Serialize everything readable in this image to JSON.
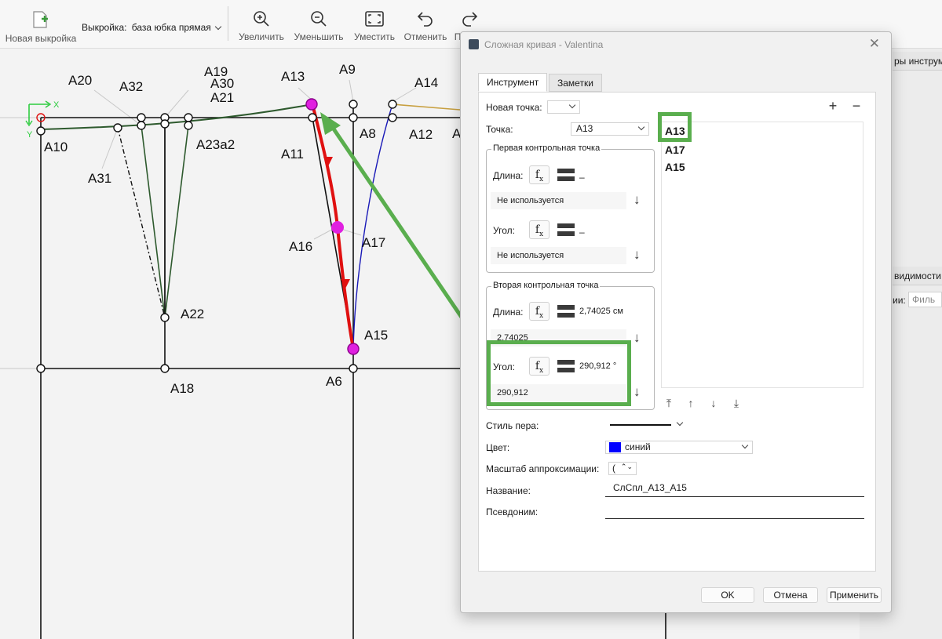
{
  "toolbar": {
    "new_pattern_label": "Новая выкройка",
    "pattern_label": "Выкройка:",
    "pattern_value": "база юбка прямая",
    "zoom_in_label": "Увеличить",
    "zoom_out_label": "Уменьшить",
    "fit_label": "Уместить",
    "undo_label": "Отменить",
    "redo_label": "П"
  },
  "canvas": {
    "axis_x": "X",
    "axis_y": "Y",
    "points": [
      "A20",
      "A32",
      "A19",
      "A30",
      "A21",
      "A13",
      "A9",
      "A14",
      "A10",
      "A23a2",
      "A8",
      "A12",
      "A",
      "A31",
      "A11",
      "A16",
      "A17",
      "A22",
      "A15",
      "A18",
      "A6"
    ]
  },
  "dock": {
    "tools_header": "ры инструм",
    "visibility_header": "видимости",
    "layer_label": "ии:",
    "filter_placeholder": "Филь"
  },
  "dialog": {
    "title": "Сложная кривая - Valentina",
    "tabs": [
      "Инструмент",
      "Заметки"
    ],
    "new_point_label": "Новая точка:",
    "point_label": "Точка:",
    "point_value": "A13",
    "first_cp": {
      "title": "Первая контрольная точка",
      "length_label": "Длина:",
      "length_value": "–",
      "length_formula": "Не используется",
      "angle_label": "Угол:",
      "angle_value": "–",
      "angle_formula": "Не используется"
    },
    "second_cp": {
      "title": "Вторая контрольная точка",
      "length_label": "Длина:",
      "length_value": "2,74025 см",
      "length_formula": "2,74025",
      "angle_label": "Угол:",
      "angle_value": "290,912 °",
      "angle_formula": "290,912"
    },
    "point_list": [
      "A13",
      "A17",
      "A15"
    ],
    "pen_style_label": "Стиль пера:",
    "color_label": "Цвет:",
    "color_value": "синий",
    "color_swatch": "#0000ff",
    "approx_label": "Масштаб аппроксимации:",
    "approx_value": "(",
    "name_label": "Название:",
    "name_value": "СлСпл_A13_A15",
    "alias_label": "Псевдоним:",
    "alias_value": "",
    "ok_label": "OK",
    "cancel_label": "Отмена",
    "apply_label": "Применить"
  },
  "colors": {
    "highlight": "#5aae4e",
    "curve_red": "#e01010",
    "curve_blue": "#1a1ab8",
    "curve_green": "#2e5a2e",
    "point_magenta": "#e020e0"
  }
}
